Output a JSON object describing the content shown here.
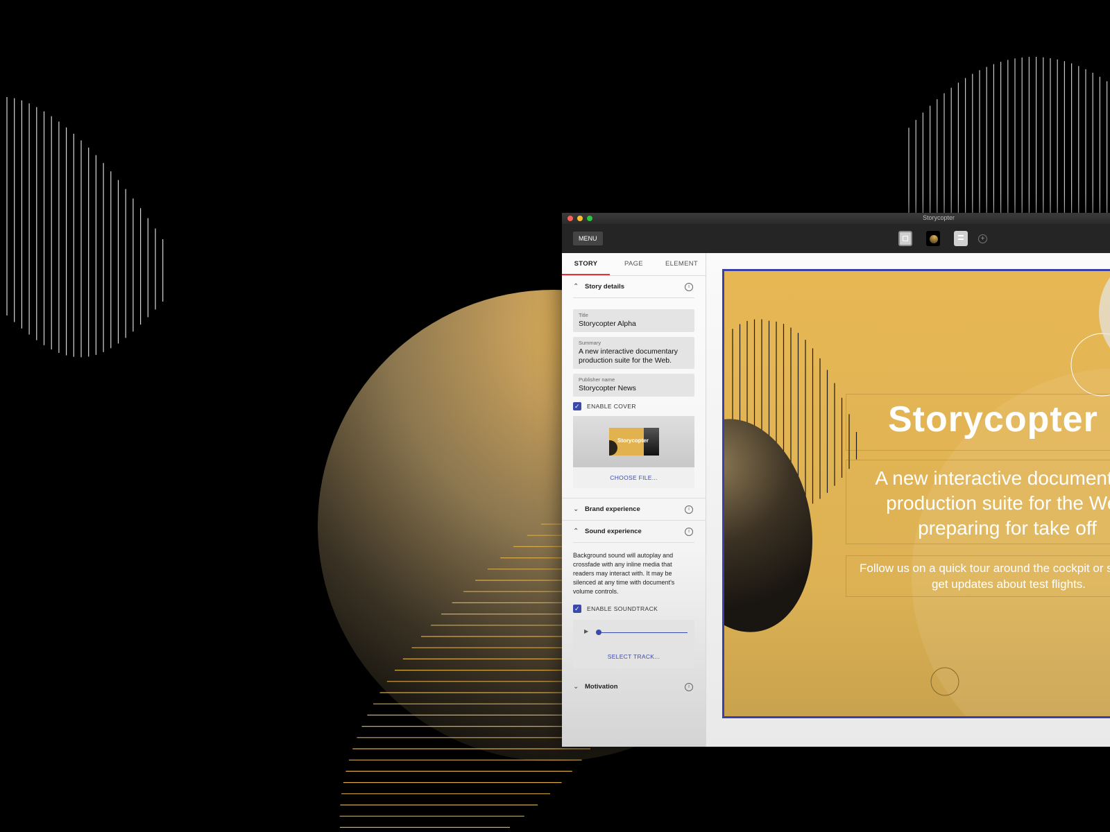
{
  "window": {
    "title": "Storycopter",
    "traffic_lights": [
      "#fe5f57",
      "#febc2e",
      "#28c840"
    ]
  },
  "toolbar": {
    "menu_label": "MENU"
  },
  "tabs": [
    {
      "label": "STORY",
      "active": true
    },
    {
      "label": "PAGE",
      "active": false
    },
    {
      "label": "ELEMENT",
      "active": false
    }
  ],
  "sections": {
    "story_details": {
      "label": "Story details",
      "expanded": true
    },
    "brand_experience": {
      "label": "Brand experience",
      "expanded": false
    },
    "sound_experience": {
      "label": "Sound experience",
      "expanded": true
    },
    "motivation": {
      "label": "Motivation",
      "expanded": false
    }
  },
  "fields": {
    "title": {
      "label": "Title",
      "value": "Storycopter Alpha"
    },
    "summary": {
      "label": "Summary",
      "value": "A new interactive documentary production suite for the Web."
    },
    "publisher": {
      "label": "Publisher name",
      "value": "Storycopter News"
    }
  },
  "cover": {
    "checkbox_label": "ENABLE COVER",
    "checked": true,
    "thumb_text": "Storycopter",
    "choose_label": "CHOOSE FILE..."
  },
  "sound": {
    "description": "Background sound will autoplay and crossfade with any inline media that readers may interact with. It may be silenced at any time with document's volume controls.",
    "checkbox_label": "ENABLE SOUNDTRACK",
    "checked": true,
    "progress": 0,
    "select_label": "SELECT TRACK..."
  },
  "preview": {
    "heading": "Storycopter",
    "subheading": "A new interactive documentary production suite for the Web preparing for take off",
    "body": "Follow us on a quick tour around the cockpit or sign up to get updates about test flights."
  },
  "colors": {
    "accent": "#3b4aa8",
    "tab_indicator": "#e2323a",
    "gold": "#e4b553"
  },
  "icons": [
    "chevron-up-icon",
    "chevron-down-icon",
    "info-icon",
    "check-icon",
    "play-icon",
    "add-icon"
  ]
}
